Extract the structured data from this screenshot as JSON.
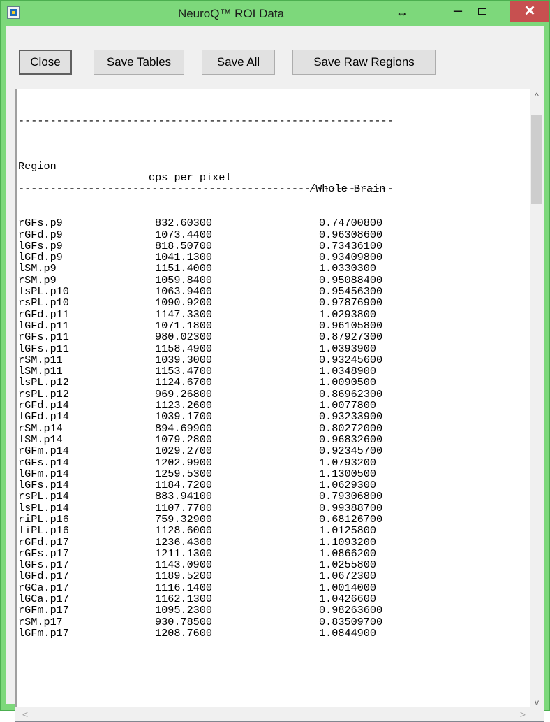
{
  "window": {
    "title": "NeuroQ™ ROI Data",
    "app_icon": "app-icon",
    "resize_icon": "↔",
    "minimize": "–",
    "close": "✕"
  },
  "toolbar": {
    "close_label": "Close",
    "save_tables_label": "Save Tables",
    "save_all_label": "Save All",
    "save_raw_label": "Save Raw Regions"
  },
  "table": {
    "dashes": "-----------------------------------------------------------",
    "headers": [
      "Region",
      "cps per pixel",
      "/Whole Brain"
    ],
    "rows": [
      [
        "rGFs.p9",
        "832.60300",
        "0.74700800"
      ],
      [
        "rGFd.p9",
        "1073.4400",
        "0.96308600"
      ],
      [
        "lGFs.p9",
        "818.50700",
        "0.73436100"
      ],
      [
        "lGFd.p9",
        "1041.1300",
        "0.93409800"
      ],
      [
        "lSM.p9",
        "1151.4000",
        "1.0330300"
      ],
      [
        "rSM.p9",
        "1059.8400",
        "0.95088400"
      ],
      [
        "lsPL.p10",
        "1063.9400",
        "0.95456300"
      ],
      [
        "rsPL.p10",
        "1090.9200",
        "0.97876900"
      ],
      [
        "rGFd.p11",
        "1147.3300",
        "1.0293800"
      ],
      [
        "lGFd.p11",
        "1071.1800",
        "0.96105800"
      ],
      [
        "rGFs.p11",
        "980.02300",
        "0.87927300"
      ],
      [
        "lGFs.p11",
        "1158.4900",
        "1.0393900"
      ],
      [
        "rSM.p11",
        "1039.3000",
        "0.93245600"
      ],
      [
        "lSM.p11",
        "1153.4700",
        "1.0348900"
      ],
      [
        "lsPL.p12",
        "1124.6700",
        "1.0090500"
      ],
      [
        "rsPL.p12",
        "969.26800",
        "0.86962300"
      ],
      [
        "rGFd.p14",
        "1123.2600",
        "1.0077800"
      ],
      [
        "lGFd.p14",
        "1039.1700",
        "0.93233900"
      ],
      [
        "rSM.p14",
        "894.69900",
        "0.80272000"
      ],
      [
        "lSM.p14",
        "1079.2800",
        "0.96832600"
      ],
      [
        "rGFm.p14",
        "1029.2700",
        "0.92345700"
      ],
      [
        "rGFs.p14",
        "1202.9900",
        "1.0793200"
      ],
      [
        "lGFm.p14",
        "1259.5300",
        "1.1300500"
      ],
      [
        "lGFs.p14",
        "1184.7200",
        "1.0629300"
      ],
      [
        "rsPL.p14",
        "883.94100",
        "0.79306800"
      ],
      [
        "lsPL.p14",
        "1107.7700",
        "0.99388700"
      ],
      [
        "riPL.p16",
        "759.32900",
        "0.68126700"
      ],
      [
        "liPL.p16",
        "1128.6000",
        "1.0125800"
      ],
      [
        "rGFd.p17",
        "1236.4300",
        "1.1093200"
      ],
      [
        "rGFs.p17",
        "1211.1300",
        "1.0866200"
      ],
      [
        "lGFs.p17",
        "1143.0900",
        "1.0255800"
      ],
      [
        "lGFd.p17",
        "1189.5200",
        "1.0672300"
      ],
      [
        "rGCa.p17",
        "1116.1400",
        "1.0014000"
      ],
      [
        "lGCa.p17",
        "1162.1300",
        "1.0426600"
      ],
      [
        "rGFm.p17",
        "1095.2300",
        "0.98263600"
      ],
      [
        "rSM.p17",
        "930.78500",
        "0.83509700"
      ],
      [
        "lGFm.p17",
        "1208.7600",
        "1.0844900"
      ]
    ]
  },
  "scrollbars": {
    "up": "^",
    "down": "v",
    "left": "<",
    "right": ">"
  }
}
